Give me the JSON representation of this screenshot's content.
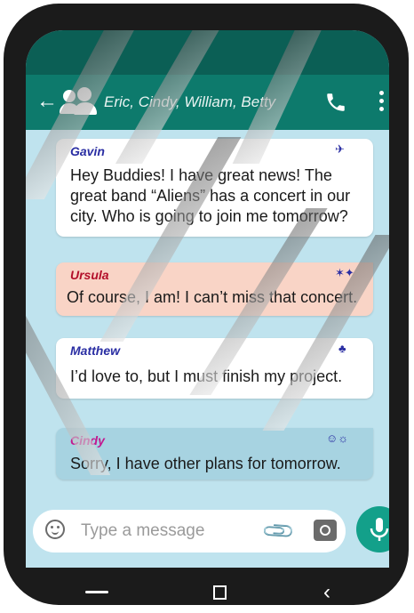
{
  "header": {
    "title": "Eric, Cindy, William, Betty",
    "back_icon": "arrow-left-icon",
    "group_icon": "group-icon",
    "call_icon": "phone-icon",
    "menu_icon": "more-vertical-icon"
  },
  "messages": [
    {
      "sender": "Gavin",
      "sender_color": "#2a2ea3",
      "text": [
        "Hey Buddies! I have great news! The",
        "great band “Aliens” has a concert in our",
        "city. Who is going to join me tomorrow?"
      ],
      "emoji": "✈",
      "emoji_name": "airplane-emoji"
    },
    {
      "sender": "Ursula",
      "sender_color": "#b30f2a",
      "text": [
        "Of course, I am! I can’t miss that concert."
      ],
      "emoji": "✶✦",
      "emoji_name": "sparkle-emoji"
    },
    {
      "sender": "Matthew",
      "sender_color": "#2a2ea3",
      "text": [
        "I’d love to, but I must finish my project."
      ],
      "emoji": "♣",
      "emoji_name": "bomb-emoji"
    },
    {
      "sender": "Cindy",
      "sender_color": "#c2188f",
      "text": [
        "Sorry, I have other plans for tomorrow."
      ],
      "emoji": "☺☼",
      "emoji_name": "smiley-emoji"
    }
  ],
  "composer": {
    "placeholder": "Type a message",
    "emoji_icon": "emoji-icon",
    "attach_icon": "paperclip-icon",
    "camera_icon": "camera-icon",
    "mic_icon": "microphone-icon"
  },
  "colors": {
    "status_bar": "#0b5f55",
    "app_bar": "#0d7a6c",
    "chat_bg": "#bfe3ee",
    "bubble_white": "#ffffff",
    "bubble_pink": "#f9d4c6",
    "bubble_blue": "#a7d3e1",
    "mic_button": "#13a08a"
  },
  "navbar": {
    "home_icon": "nav-home-icon",
    "recents_icon": "nav-recents-icon",
    "back_icon": "nav-back-icon"
  }
}
